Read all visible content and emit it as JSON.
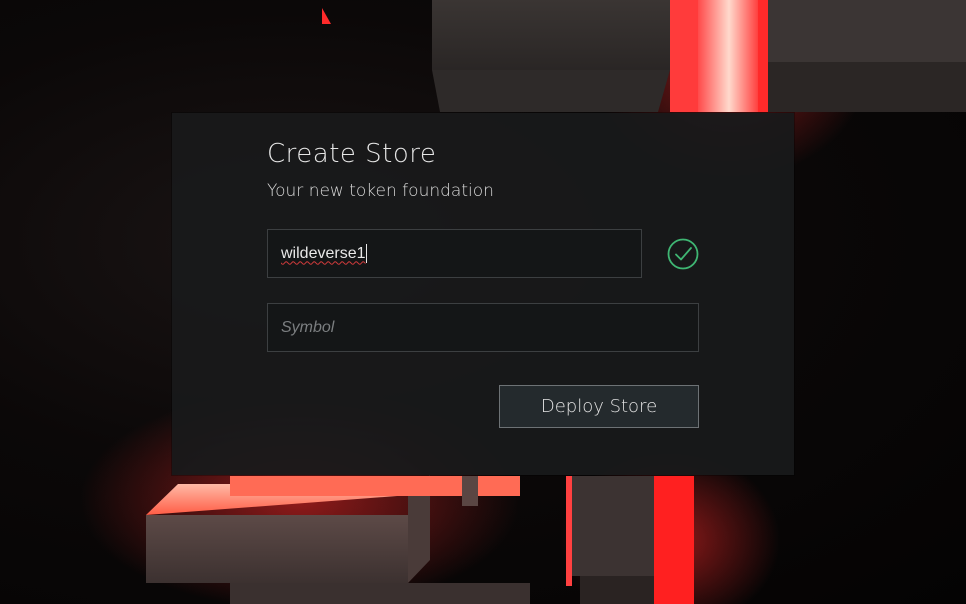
{
  "dialog": {
    "title": "Create Store",
    "subtitle": "Your new token foundation"
  },
  "form": {
    "name_value": "wildeverse1",
    "name_valid": true,
    "symbol_value": "",
    "symbol_placeholder": "Symbol"
  },
  "actions": {
    "deploy_label": "Deploy Store"
  },
  "icons": {
    "valid": "check-circle-icon"
  },
  "colors": {
    "accent_green": "#3fb673",
    "glow_red": "#ff2a2a",
    "panel_bg": "#181a1b"
  }
}
